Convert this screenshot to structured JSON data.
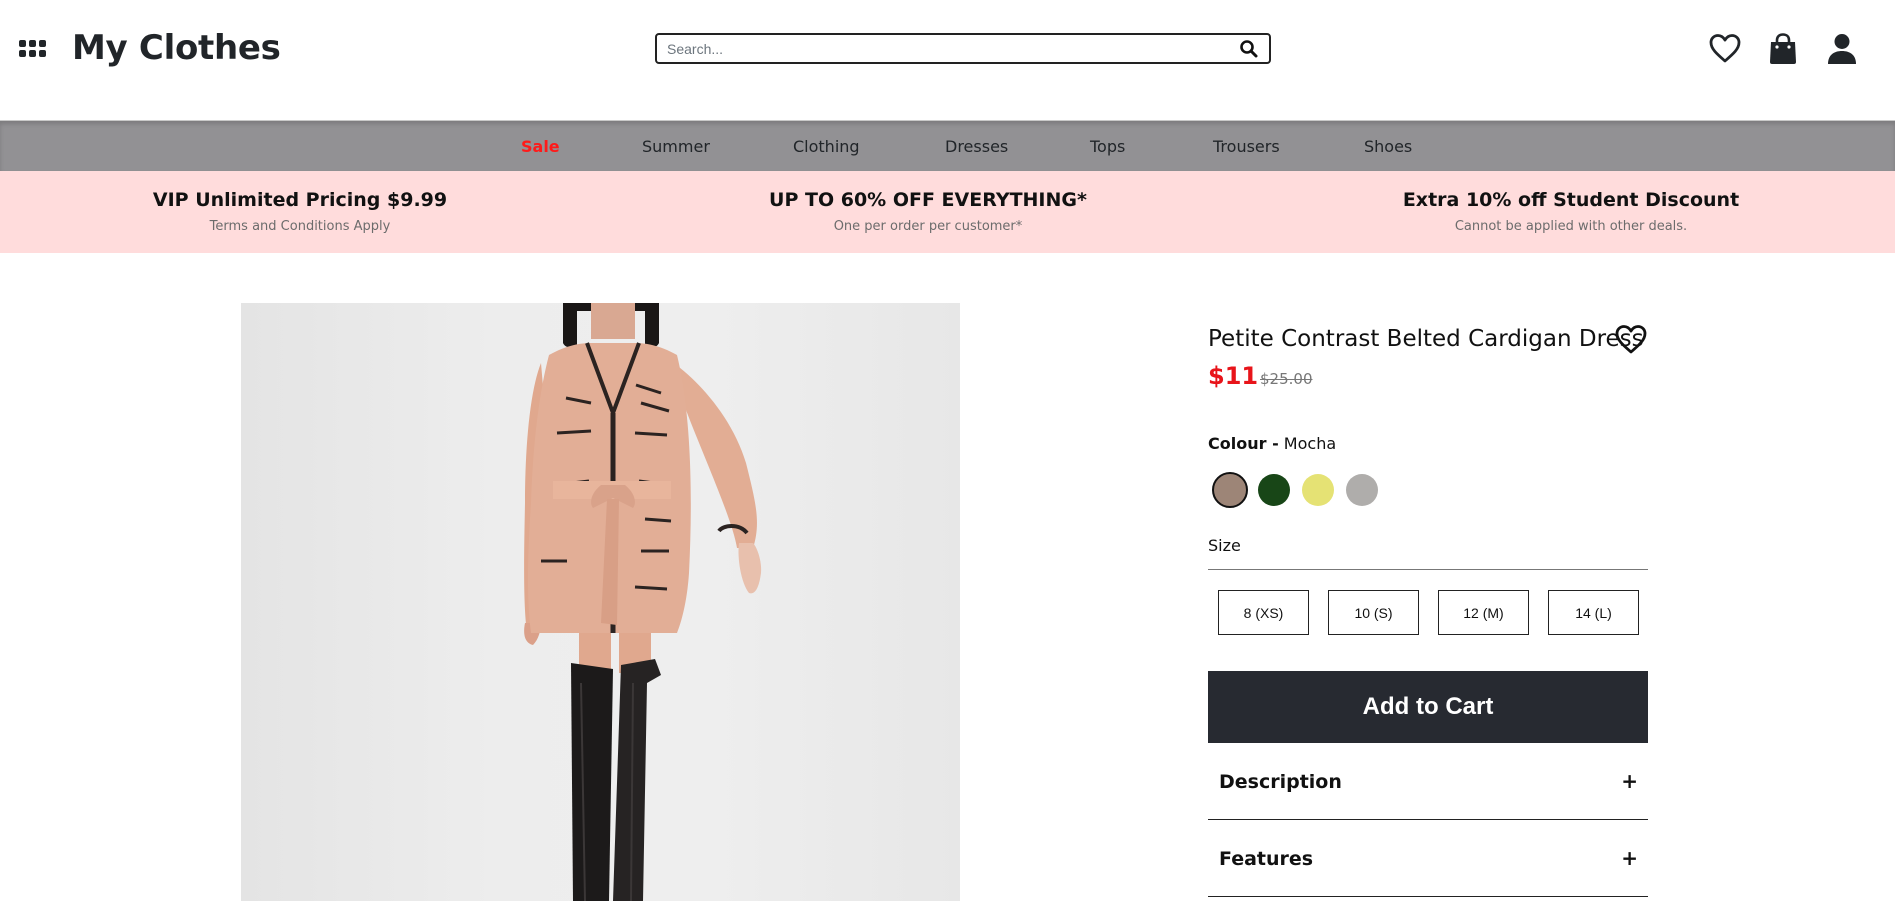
{
  "header": {
    "brand": "My Clothes",
    "search_placeholder": "Search..."
  },
  "nav": {
    "items": [
      "Sale",
      "Summer",
      "Clothing",
      "Dresses",
      "Tops",
      "Trousers",
      "Shoes"
    ],
    "sale_color": "#ff1a1a"
  },
  "promo": {
    "items": [
      {
        "title": "VIP Unlimited Pricing $9.99",
        "subtitle": "Terms and Conditions Apply"
      },
      {
        "title": "UP TO 60% OFF EVERYTHING*",
        "subtitle": "One per order per customer*"
      },
      {
        "title": "Extra 10% off Student Discount",
        "subtitle": "Cannot be applied with other deals."
      }
    ],
    "background": "#ffdcdc"
  },
  "product": {
    "title": "Petite Contrast Belted Cardigan Dress",
    "price": "$11",
    "old_price": "$25.00",
    "colour_label": "Colour -",
    "colour_value": "Mocha",
    "swatches": [
      {
        "name": "Mocha",
        "hex": "#9d8577",
        "selected": true
      },
      {
        "name": "Green",
        "hex": "#184617",
        "selected": false
      },
      {
        "name": "Yellow",
        "hex": "#e5e274",
        "selected": false
      },
      {
        "name": "Grey",
        "hex": "#afadab",
        "selected": false
      }
    ],
    "size_label": "Size",
    "sizes": [
      "8 (XS)",
      "10 (S)",
      "12 (M)",
      "14 (L)"
    ],
    "add_to_cart": "Add to Cart",
    "accordions": [
      {
        "label": "Description",
        "icon": "+"
      },
      {
        "label": "Features",
        "icon": "+"
      }
    ]
  },
  "colors": {
    "accent_dark": "#272a31",
    "sale_red": "#e8141a",
    "nav_bg": "#929194"
  }
}
